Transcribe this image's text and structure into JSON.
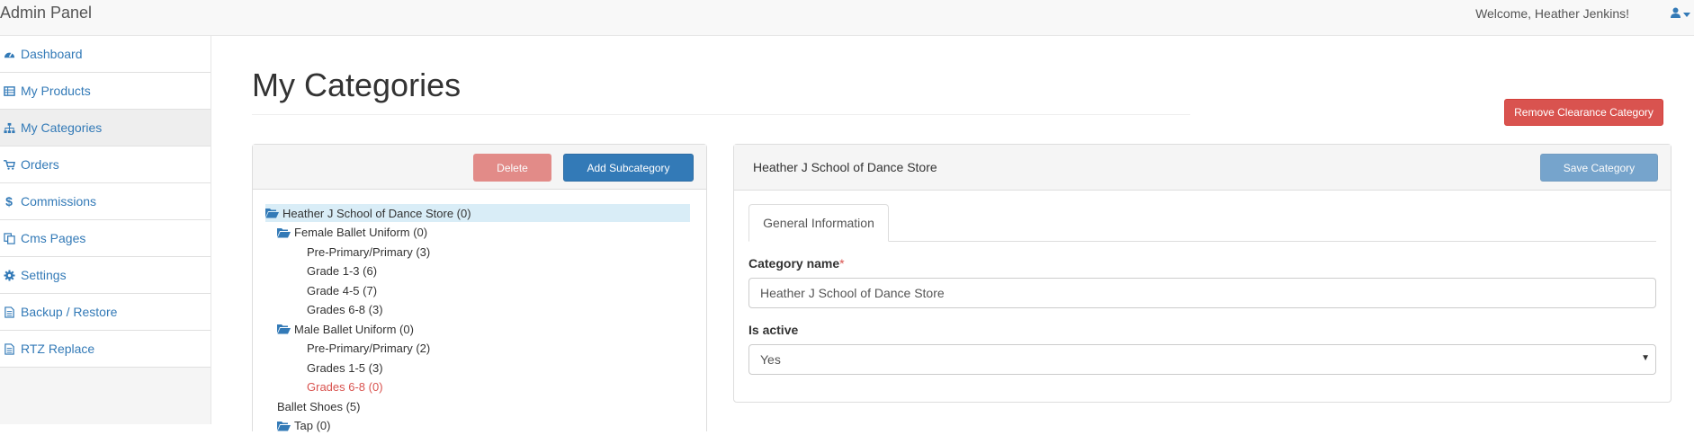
{
  "app": {
    "title": "Admin Panel",
    "welcome": "Welcome, Heather Jenkins!",
    "user_icon": "user-icon"
  },
  "sidebar": {
    "items": [
      {
        "label": "Dashboard",
        "icon": "dashboard-icon"
      },
      {
        "label": "My Products",
        "icon": "table-icon"
      },
      {
        "label": "My Categories",
        "icon": "sitemap-icon",
        "active": true
      },
      {
        "label": "Orders",
        "icon": "shopping-cart-icon"
      },
      {
        "label": "Commissions",
        "icon": "dollar-icon"
      },
      {
        "label": "Cms Pages",
        "icon": "copy-icon"
      },
      {
        "label": "Settings",
        "icon": "gear-icon"
      },
      {
        "label": "Backup / Restore",
        "icon": "file-icon"
      },
      {
        "label": "RTZ Replace",
        "icon": "file-icon"
      }
    ]
  },
  "page": {
    "title": "My Categories",
    "remove_button": "Remove Clearance Category"
  },
  "tree": {
    "delete_button": "Delete",
    "add_button": "Add Subcategory",
    "nodes": [
      {
        "label": "Heather J School of Dance Store (0)",
        "level": 0,
        "folder": true,
        "selected": true
      },
      {
        "label": "Female Ballet Uniform (0)",
        "level": 1,
        "folder": true
      },
      {
        "label": "Pre-Primary/Primary (3)",
        "level": 2
      },
      {
        "label": "Grade 1-3 (6)",
        "level": 2
      },
      {
        "label": "Grade 4-5 (7)",
        "level": 2
      },
      {
        "label": "Grades 6-8 (3)",
        "level": 2
      },
      {
        "label": "Male Ballet Uniform (0)",
        "level": 1,
        "folder": true
      },
      {
        "label": "Pre-Primary/Primary (2)",
        "level": 2
      },
      {
        "label": "Grades 1-5 (3)",
        "level": 2
      },
      {
        "label": "Grades 6-8 (0)",
        "level": 2,
        "red": true
      },
      {
        "label": "Ballet Shoes (5)",
        "level": 1
      },
      {
        "label": "Tap (0)",
        "level": 1,
        "folder": true
      }
    ]
  },
  "detail": {
    "title": "Heather J School of Dance Store",
    "save_button": "Save Category",
    "tab": "General Information",
    "name_label": "Category name",
    "required_mark": "*",
    "name_value": "Heather J School of Dance Store",
    "active_label": "Is active",
    "active_value": "Yes"
  },
  "colors": {
    "link": "#337ab7",
    "danger": "#d9534f",
    "primary": "#337ab7"
  }
}
